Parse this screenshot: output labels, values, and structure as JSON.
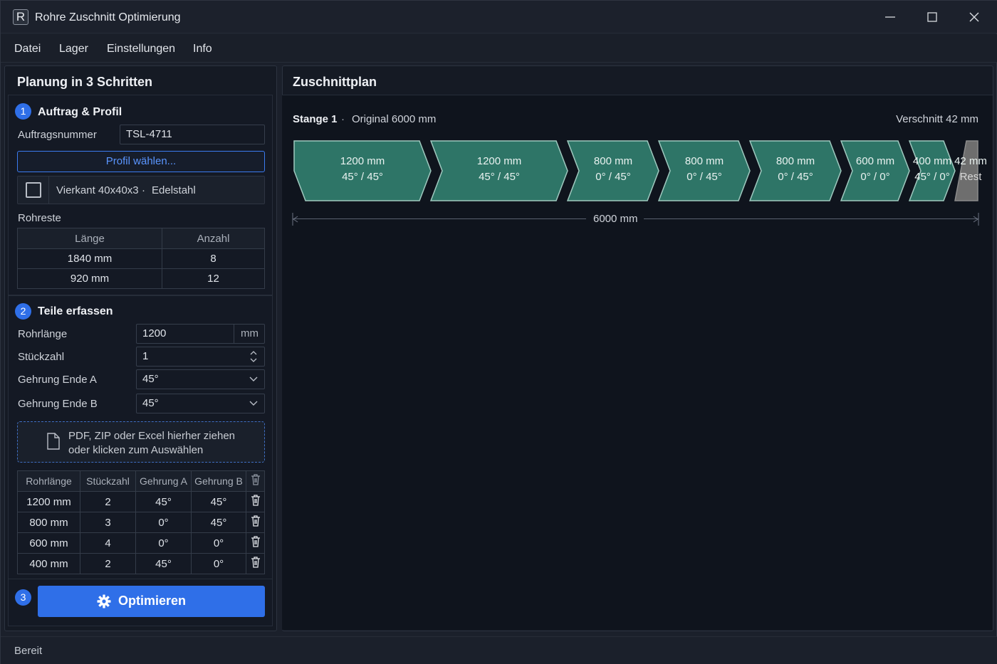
{
  "window": {
    "title": "Rohre Zuschnitt Optimierung",
    "icon_letter": "R"
  },
  "menu": [
    "Datei",
    "Lager",
    "Einstellungen",
    "Info"
  ],
  "left": {
    "title": "Planung in 3 Schritten",
    "step1": {
      "num": "1",
      "title": "Auftrag & Profil",
      "order_label": "Auftragsnummer",
      "order_value": "TSL-4711",
      "profile_button": "Profil wählen...",
      "profile_name": "Vierkant 40x40x3",
      "profile_sep": "·",
      "profile_material": "Edelstahl",
      "remnants_label": "Rohreste",
      "remnants_headers": [
        "Länge",
        "Anzahl"
      ],
      "remnants_rows": [
        [
          "1840 mm",
          "8"
        ],
        [
          "920 mm",
          "12"
        ]
      ]
    },
    "step2": {
      "num": "2",
      "title": "Teile erfassen",
      "length_label": "Rohrlänge",
      "length_value": "1200",
      "length_unit": "mm",
      "qty_label": "Stückzahl",
      "qty_value": "1",
      "miter_a_label": "Gehrung Ende A",
      "miter_a_value": "45°",
      "miter_b_label": "Gehrung Ende B",
      "miter_b_value": "45°",
      "drop_line1": "PDF, ZIP oder Excel hierher ziehen",
      "drop_line2": "oder klicken zum Auswählen",
      "parts_headers": [
        "Rohrlänge",
        "Stückzahl",
        "Gehrung A",
        "Gehrung B"
      ],
      "parts_rows": [
        [
          "1200 mm",
          "2",
          "45°",
          "45°"
        ],
        [
          "800 mm",
          "3",
          "0°",
          "45°"
        ],
        [
          "600 mm",
          "4",
          "0°",
          "0°"
        ],
        [
          "400 mm",
          "2",
          "45°",
          "0°"
        ]
      ]
    },
    "step3": {
      "num": "3",
      "button": "Optimieren"
    }
  },
  "plan": {
    "title": "Zuschnittplan",
    "bar_label": "Stange 1",
    "bar_sep": "·",
    "original": "Original 6000 mm",
    "waste": "Verschnitt 42 mm",
    "total_mm": 6000,
    "dimension": "6000 mm",
    "colors": {
      "segment": "#2e7567",
      "segment_border": "#9fc9bf",
      "rest": "#6e6e6e"
    },
    "segments": [
      {
        "length": "1200 mm",
        "angles": "45° / 45°",
        "mm": 1200
      },
      {
        "length": "1200 mm",
        "angles": "45° / 45°",
        "mm": 1200
      },
      {
        "length": "800 mm",
        "angles": "0° / 45°",
        "mm": 800
      },
      {
        "length": "800 mm",
        "angles": "0° / 45°",
        "mm": 800
      },
      {
        "length": "800 mm",
        "angles": "0° / 45°",
        "mm": 800
      },
      {
        "length": "600 mm",
        "angles": "0° / 0°",
        "mm": 600
      },
      {
        "length": "400 mm",
        "angles": "45° / 0°",
        "mm": 400
      }
    ],
    "rest": {
      "length": "42 mm",
      "label": "Rest",
      "mm": 42
    }
  },
  "status": "Bereit"
}
